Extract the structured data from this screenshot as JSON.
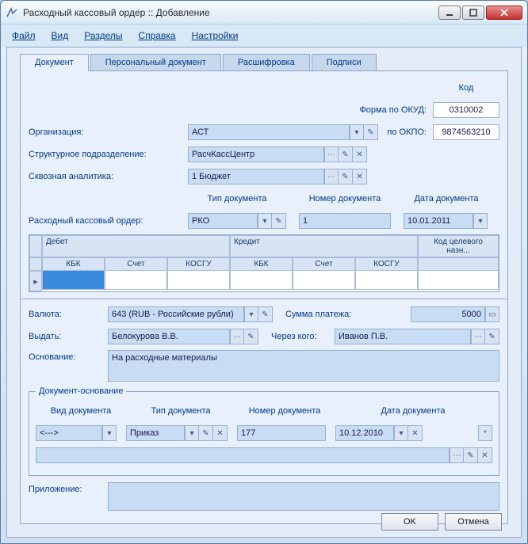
{
  "window": {
    "title": "Расходный кассовый ордер :: Добавление"
  },
  "menu": {
    "file": "Файл",
    "view": "Вид",
    "sections": "Разделы",
    "help": "Справка",
    "settings": "Настройки"
  },
  "tabs": {
    "document": "Документ",
    "personal": "Персональный документ",
    "decipher": "Расшифровка",
    "signatures": "Подписи"
  },
  "labels": {
    "code": "Код",
    "form_okud": "Форма по ОКУД:",
    "okpo": "по ОКПО:",
    "organization": "Организация:",
    "subdivision": "Структурное подразделение:",
    "analytics": "Сквозная аналитика:",
    "doc_type": "Тип документа",
    "doc_number": "Номер документа",
    "doc_date": "Дата документа",
    "cash_order": "Расходный кассовый ордер:",
    "debit": "Дебет",
    "credit": "Кредит",
    "kbk": "КБК",
    "account": "Счет",
    "kosgu": "КОСГУ",
    "target_code": "Код целевого назн...",
    "currency": "Валюта:",
    "payment_sum": "Сумма платежа:",
    "issue_to": "Выдать:",
    "through": "Через кого:",
    "basis": "Основание:",
    "doc_basis_legend": "Документ-основание",
    "basis_type": "Вид документа",
    "attachment": "Приложение:"
  },
  "values": {
    "okud": "0310002",
    "okpo": "9874563210",
    "organization": "АСТ",
    "subdivision": "РасчКассЦентр",
    "analytics": "1 Бюджет",
    "doc_type": "РКО",
    "doc_number": "1",
    "doc_date": "10.01.2011",
    "currency": "643 (RUB - Российские рубли)",
    "payment_sum": "5000",
    "issue_to": "Белокурова В.В.",
    "through": "Иванов П.В.",
    "basis": "На расходные материалы",
    "basis_kind": "<--->",
    "basis_type": "Приказ",
    "basis_number": "177",
    "basis_date": "10.12.2010",
    "attachment": ""
  },
  "buttons": {
    "ok": "OK",
    "cancel": "Отмена"
  }
}
